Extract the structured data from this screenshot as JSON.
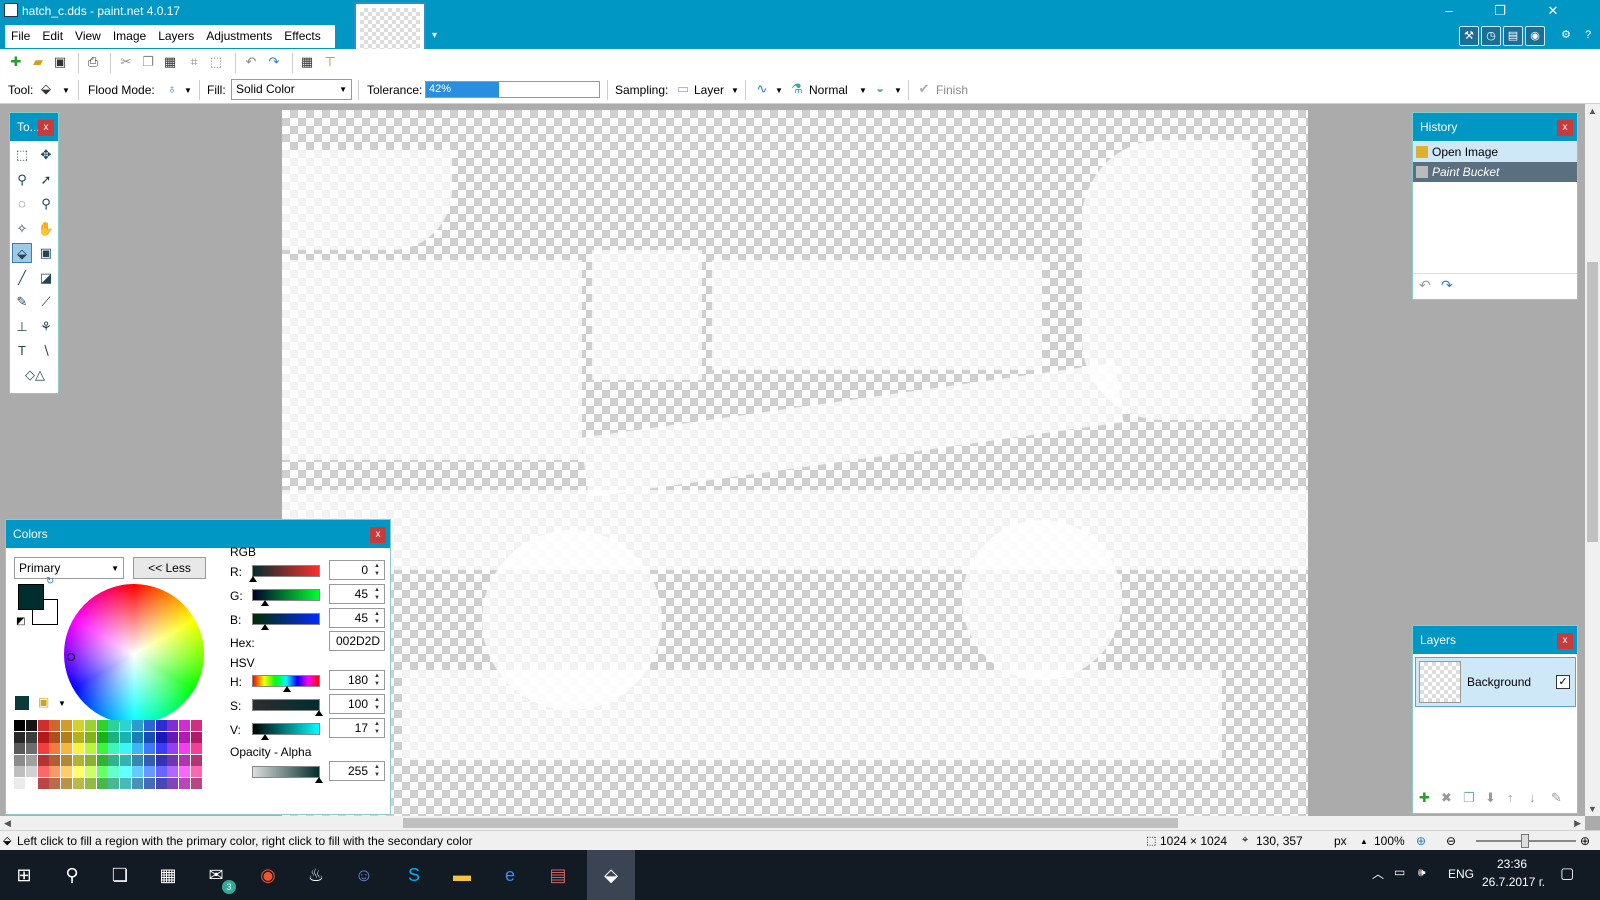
{
  "window": {
    "title": "hatch_c.dds - paint.net 4.0.17",
    "controls": {
      "minimize": "–",
      "maximize": "❐",
      "close": "✕"
    }
  },
  "menu": [
    "File",
    "Edit",
    "View",
    "Image",
    "Layers",
    "Adjustments",
    "Effects"
  ],
  "toolbar": {
    "tool_label": "Tool:",
    "flood_mode_label": "Flood Mode:",
    "fill_label": "Fill:",
    "fill_value": "Solid Color",
    "tolerance_label": "Tolerance:",
    "tolerance_value": "42%",
    "tolerance_percent": 42,
    "sampling_label": "Sampling:",
    "sampling_value": "Layer",
    "blend_value": "Normal",
    "finish_label": "Finish"
  },
  "tools_panel": {
    "title": "To..."
  },
  "history": {
    "title": "History",
    "items": [
      "Open Image",
      "Paint Bucket"
    ]
  },
  "layers": {
    "title": "Layers",
    "items": [
      {
        "name": "Background",
        "visible": true
      }
    ]
  },
  "colors": {
    "title": "Colors",
    "selector": "Primary",
    "less_button": "<< Less",
    "rgb_heading": "RGB",
    "r_label": "R:",
    "r_value": "0",
    "g_label": "G:",
    "g_value": "45",
    "b_label": "B:",
    "b_value": "45",
    "hex_label": "Hex:",
    "hex_value": "002D2D",
    "hsv_heading": "HSV",
    "h_label": "H:",
    "h_value": "180",
    "s_label": "S:",
    "s_value": "100",
    "v_label": "V:",
    "v_value": "17",
    "opacity_heading": "Opacity - Alpha",
    "alpha_value": "255",
    "primary_color": "#002D2D",
    "secondary_color": "#FFFFFF"
  },
  "status": {
    "message": "Left click to fill a region with the primary color, right click to fill with the secondary color",
    "image_size": "1024 × 1024",
    "cursor_pos": "130, 357",
    "units": "px",
    "zoom": "100%"
  },
  "taskbar": {
    "language": "ENG",
    "time": "23:36",
    "date": "26.7.2017 г.",
    "mail_badge": "3"
  },
  "accent_colors": {
    "titlebar": "#0097c4",
    "selection": "#cfe8f7",
    "taskbar": "#121a24"
  }
}
